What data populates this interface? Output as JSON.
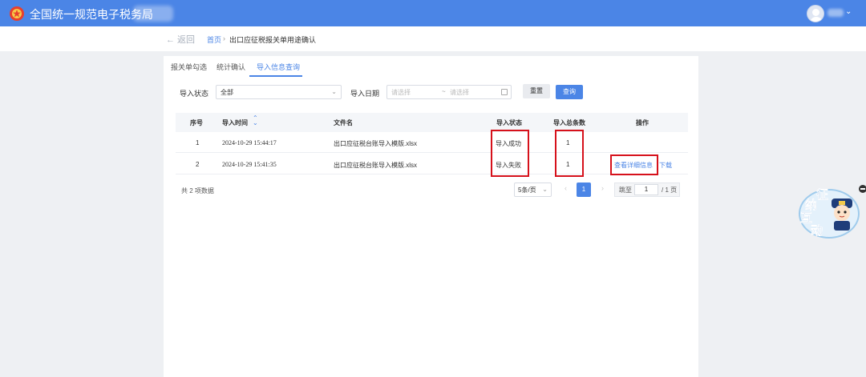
{
  "app": {
    "title": "全国统一规范电子税务局"
  },
  "user": {
    "menu_caret": "⌄"
  },
  "breadcrumb": {
    "back": "← 返回",
    "home": "首页",
    "separator": "›",
    "current": "出口应征税报关单用途确认"
  },
  "tabs": [
    {
      "label": "报关单勾选",
      "active": false
    },
    {
      "label": "统计确认",
      "active": false
    },
    {
      "label": "导入信息查询",
      "active": true
    }
  ],
  "filters": {
    "status_label": "导入状态",
    "status_value": "全部",
    "date_label": "导入日期",
    "date_start_placeholder": "请选择",
    "date_separator": "~",
    "date_end_placeholder": "请选择",
    "reset_label": "重置",
    "search_label": "查询"
  },
  "table": {
    "headers": {
      "index": "序号",
      "time": "导入时间",
      "filename": "文件名",
      "status": "导入状态",
      "count": "导入总条数",
      "actions": "操作"
    },
    "rows": [
      {
        "index": "1",
        "time": "2024-10-29 15:44:17",
        "filename": "出口应征税台账导入模版.xlsx",
        "status": "导入成功",
        "count": "1",
        "detail_link": "",
        "download_link": ""
      },
      {
        "index": "2",
        "time": "2024-10-29 15:41:35",
        "filename": "出口应征税台账导入模版.xlsx",
        "status": "导入失败",
        "count": "1",
        "detail_link": "查看详细信息",
        "download_link": "下载"
      }
    ]
  },
  "pagination": {
    "total": "共 2 项数据",
    "page_size": "5条/页",
    "prev": "‹",
    "current": "1",
    "next": "›",
    "jump_label": "跳至",
    "jump_value": "1",
    "page_total": "/ 1 页"
  },
  "helper": {
    "chars": [
      "征",
      "纳",
      "互",
      "动"
    ]
  },
  "colors": {
    "primary": "#4b85e6",
    "highlight_box": "#d6111b"
  }
}
